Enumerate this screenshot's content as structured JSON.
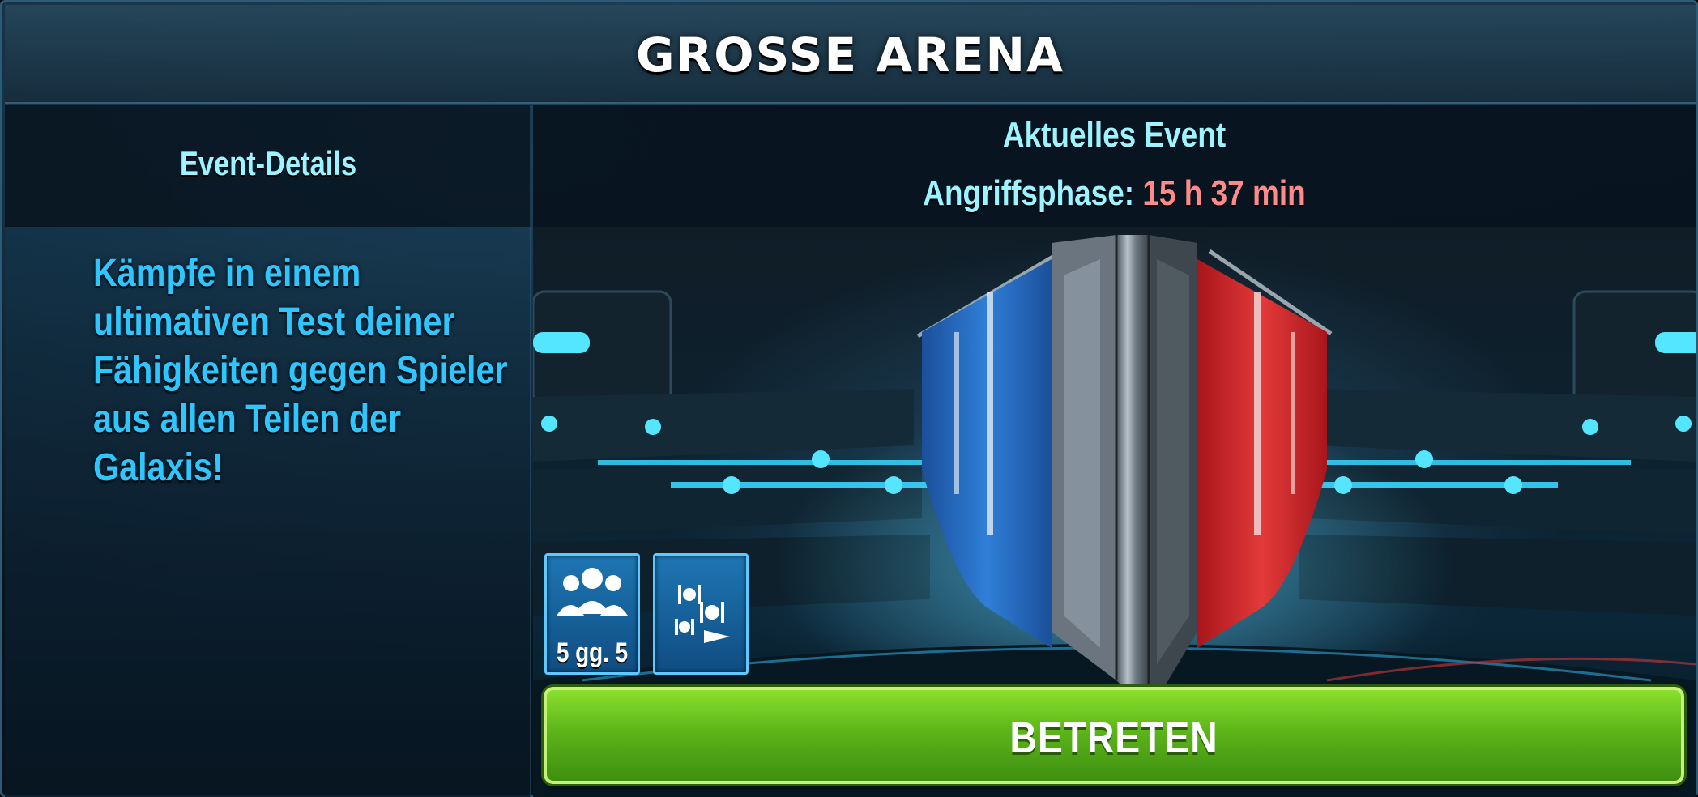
{
  "header": {
    "title": "GROSSE ARENA"
  },
  "left_panel": {
    "tab_label": "Event-Details",
    "description": "Kämpfe in einem ultimativen Test deiner Fähigkeiten gegen Spieler aus allen Teilen der Galaxis!"
  },
  "event": {
    "title": "Aktuelles Event",
    "phase_label": "Angriffsphase:",
    "phase_time": "15 h 37 min"
  },
  "badges": {
    "squad_label": "5 gg. 5",
    "squad_icon": "squad-icon",
    "fleet_icon": "fleet-ships-icon"
  },
  "actions": {
    "enter_label": "BETRETEN"
  },
  "colors": {
    "accent_cyan": "#9df3ff",
    "description_blue": "#2fc6ff",
    "timer_red": "#ff8a8a",
    "button_green": "#5cb51a",
    "badge_blue": "#1e76b3"
  }
}
